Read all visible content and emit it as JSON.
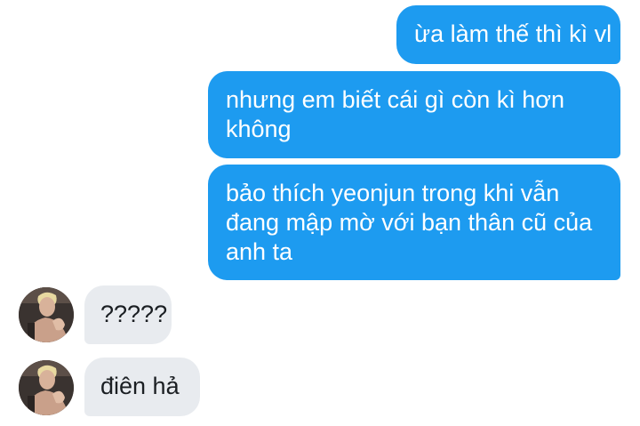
{
  "messages": [
    {
      "sender": "me",
      "text": "ừa làm thế thì kì vl"
    },
    {
      "sender": "me",
      "text": "nhưng em biết cái gì còn kì hơn\nkhông"
    },
    {
      "sender": "me",
      "text": "bảo thích yeonjun trong khi vẫn\nđang mập mờ với bạn thân cũ của\nanh ta"
    },
    {
      "sender": "other",
      "text": "?????"
    },
    {
      "sender": "other",
      "text": "điên hả"
    }
  ],
  "colors": {
    "sent_bubble": "#1d9bf0",
    "sent_text": "#ffffff",
    "received_bubble": "#e8ebef",
    "received_text": "#1b1f23"
  },
  "icons": {
    "avatar": "user-avatar-photo"
  }
}
